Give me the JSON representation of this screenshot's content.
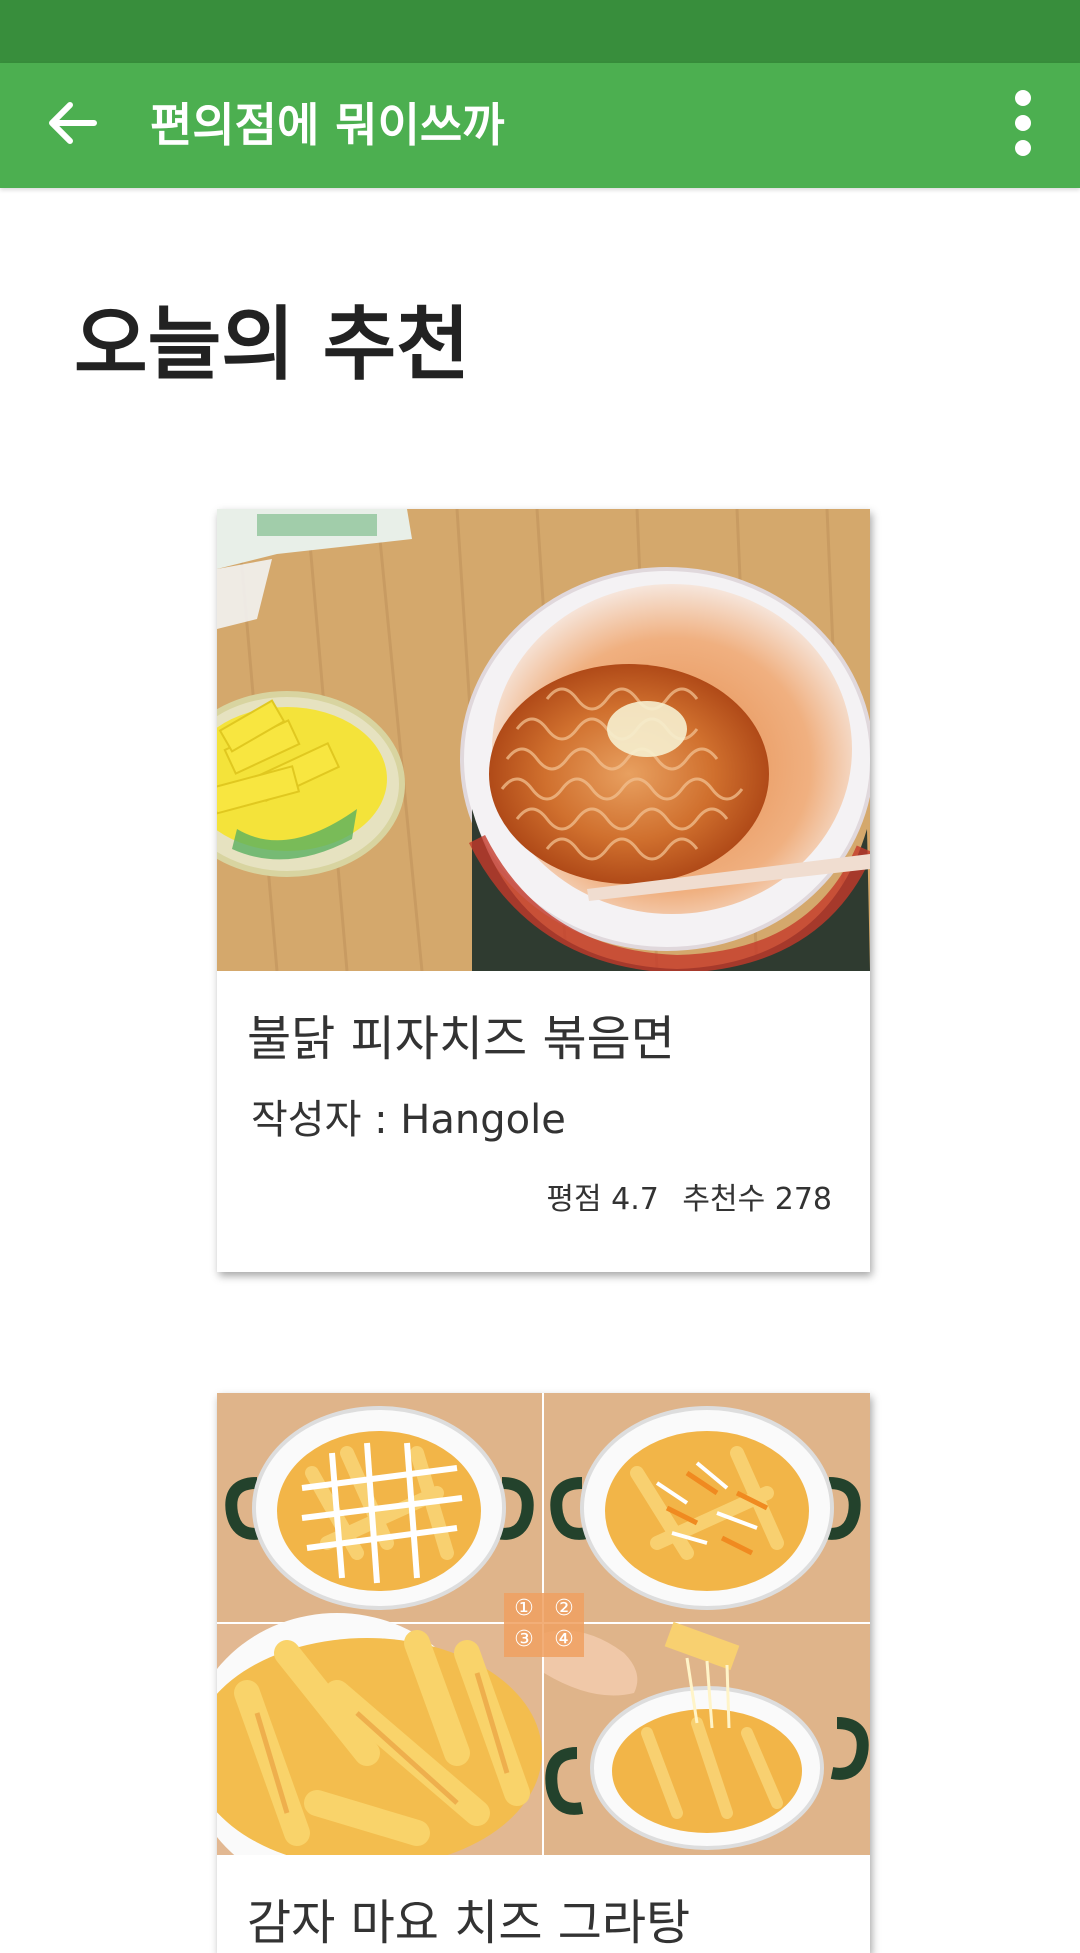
{
  "app_bar": {
    "title": "편의점에 뭐이쓰까",
    "background": "#4caf50",
    "status_bar_color": "#388e3c",
    "back_icon": "arrow-left-icon",
    "more_icon": "more-vert-icon"
  },
  "section": {
    "title": "오늘의 추천"
  },
  "cards": [
    {
      "title": "불닭 피자치즈 볶음면",
      "author": "작성자 : Hangole",
      "rating": "평점 4.7",
      "recommends": "추천수 278",
      "image": "cup-ramen-photo"
    },
    {
      "title": "감자 마요 치즈 그라탕",
      "image": "potato-gratin-collage",
      "step_labels": [
        "①",
        "②",
        "③",
        "④"
      ]
    }
  ]
}
